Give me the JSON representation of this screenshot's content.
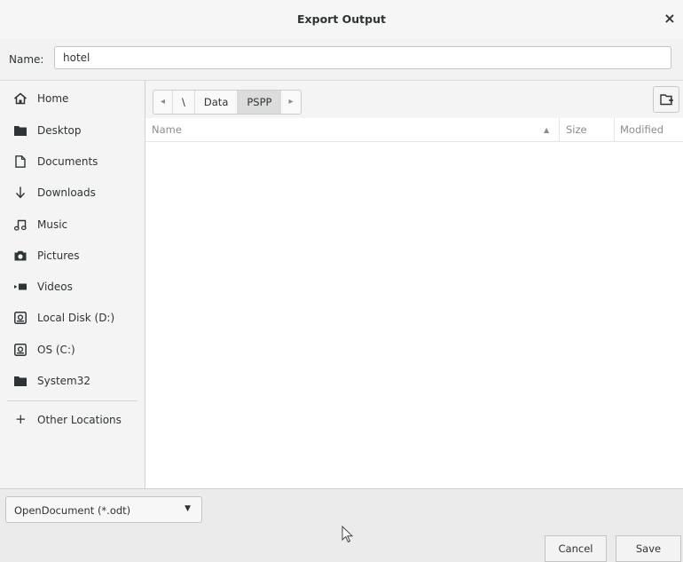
{
  "window": {
    "title": "Export Output",
    "close_symbol": "×"
  },
  "name_field": {
    "label": "Name:",
    "value": "hotel"
  },
  "sidebar": {
    "items": [
      {
        "label": "Home",
        "icon": "home-icon"
      },
      {
        "label": "Desktop",
        "icon": "folder-icon"
      },
      {
        "label": "Documents",
        "icon": "document-icon"
      },
      {
        "label": "Downloads",
        "icon": "download-icon"
      },
      {
        "label": "Music",
        "icon": "music-icon"
      },
      {
        "label": "Pictures",
        "icon": "camera-icon"
      },
      {
        "label": "Videos",
        "icon": "video-icon"
      },
      {
        "label": "Local Disk (D:)",
        "icon": "drive-icon"
      },
      {
        "label": "OS (C:)",
        "icon": "drive-icon"
      },
      {
        "label": "System32",
        "icon": "folder-icon"
      }
    ],
    "other_locations": "Other Locations",
    "plus_symbol": "+"
  },
  "path_bar": {
    "back_arrow": "◂",
    "forward_arrow": "▸",
    "crumbs": [
      "\\",
      "Data",
      "PSPP"
    ],
    "active_crumb": "PSPP"
  },
  "columns": {
    "name": "Name",
    "size": "Size",
    "modified": "Modified",
    "sort_indicator": "▲"
  },
  "file_filter": {
    "selected": "OpenDocument (*.odt)",
    "dropdown_symbol": "▼"
  },
  "buttons": {
    "cancel": "Cancel",
    "save": "Save"
  }
}
